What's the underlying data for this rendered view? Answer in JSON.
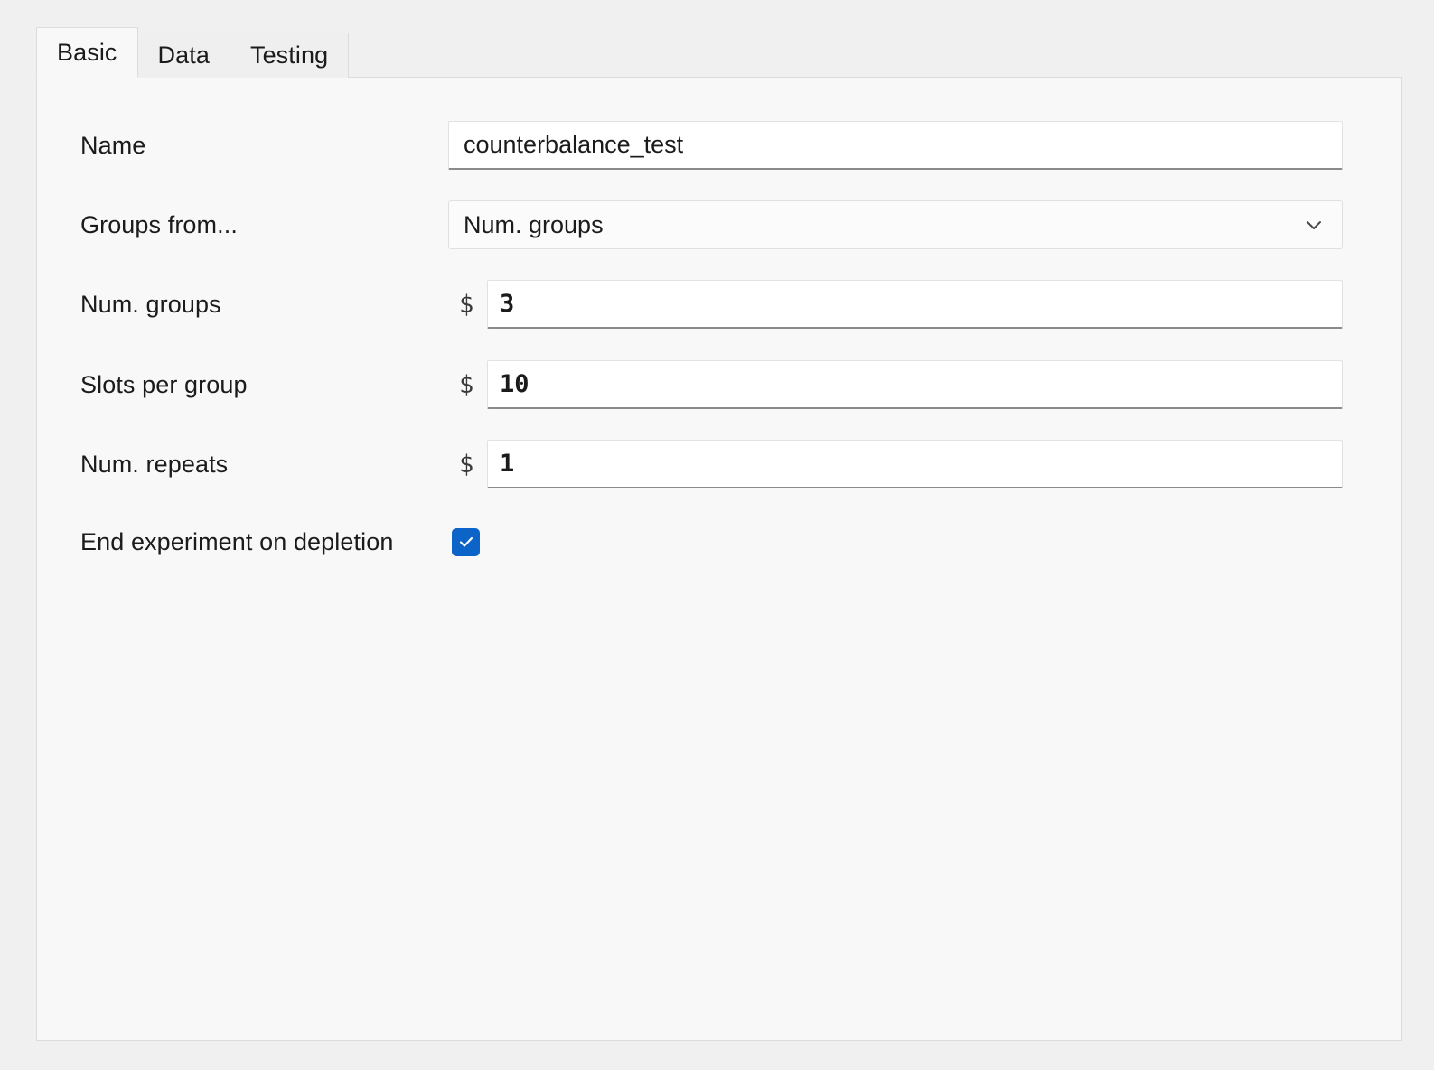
{
  "window": {
    "background_color": "#f0f0f0",
    "panel_color": "#f8f8f8",
    "accent_color": "#0c63c8"
  },
  "tabs": [
    {
      "label": "Basic",
      "active": true
    },
    {
      "label": "Data",
      "active": false
    },
    {
      "label": "Testing",
      "active": false
    }
  ],
  "form": {
    "name": {
      "label": "Name",
      "value": "counterbalance_test",
      "placeholder": ""
    },
    "groups_from": {
      "label": "Groups from...",
      "value": "Num. groups",
      "options": [
        "Num. groups"
      ],
      "chevron_icon": "chevron-down-icon"
    },
    "num_groups": {
      "label": "Num. groups",
      "value": "3",
      "spinner_glyph": "$"
    },
    "slots_per_group": {
      "label": "Slots per group",
      "value": "10",
      "spinner_glyph": "$"
    },
    "num_repeats": {
      "label": "Num. repeats",
      "value": "1",
      "spinner_glyph": "$"
    },
    "end_on_depletion": {
      "label": "End experiment on depletion",
      "checked": true,
      "check_icon": "check-icon"
    }
  }
}
